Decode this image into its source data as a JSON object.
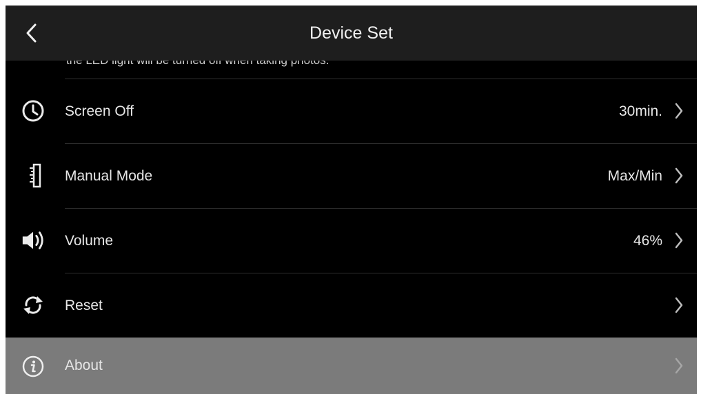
{
  "header": {
    "title": "Device Set",
    "back_icon": "chevron-left-icon"
  },
  "partial_row": {
    "text": "the LED light will be turned off when taking photos."
  },
  "items": [
    {
      "label": "Screen Off",
      "value": "30min.",
      "icon": "clock-icon"
    },
    {
      "label": "Manual Mode",
      "value": "Max/Min",
      "icon": "ruler-icon"
    },
    {
      "label": "Volume",
      "value": "46%",
      "icon": "speaker-icon"
    },
    {
      "label": "Reset",
      "value": "",
      "icon": "reset-icon"
    },
    {
      "label": "About",
      "value": "",
      "icon": "info-icon",
      "selected": true
    }
  ],
  "colors": {
    "header_bg": "#1e1e1e",
    "screen_bg": "#000000",
    "selected_row_bg": "#7b7b7b",
    "text": "#e6e6e6"
  }
}
